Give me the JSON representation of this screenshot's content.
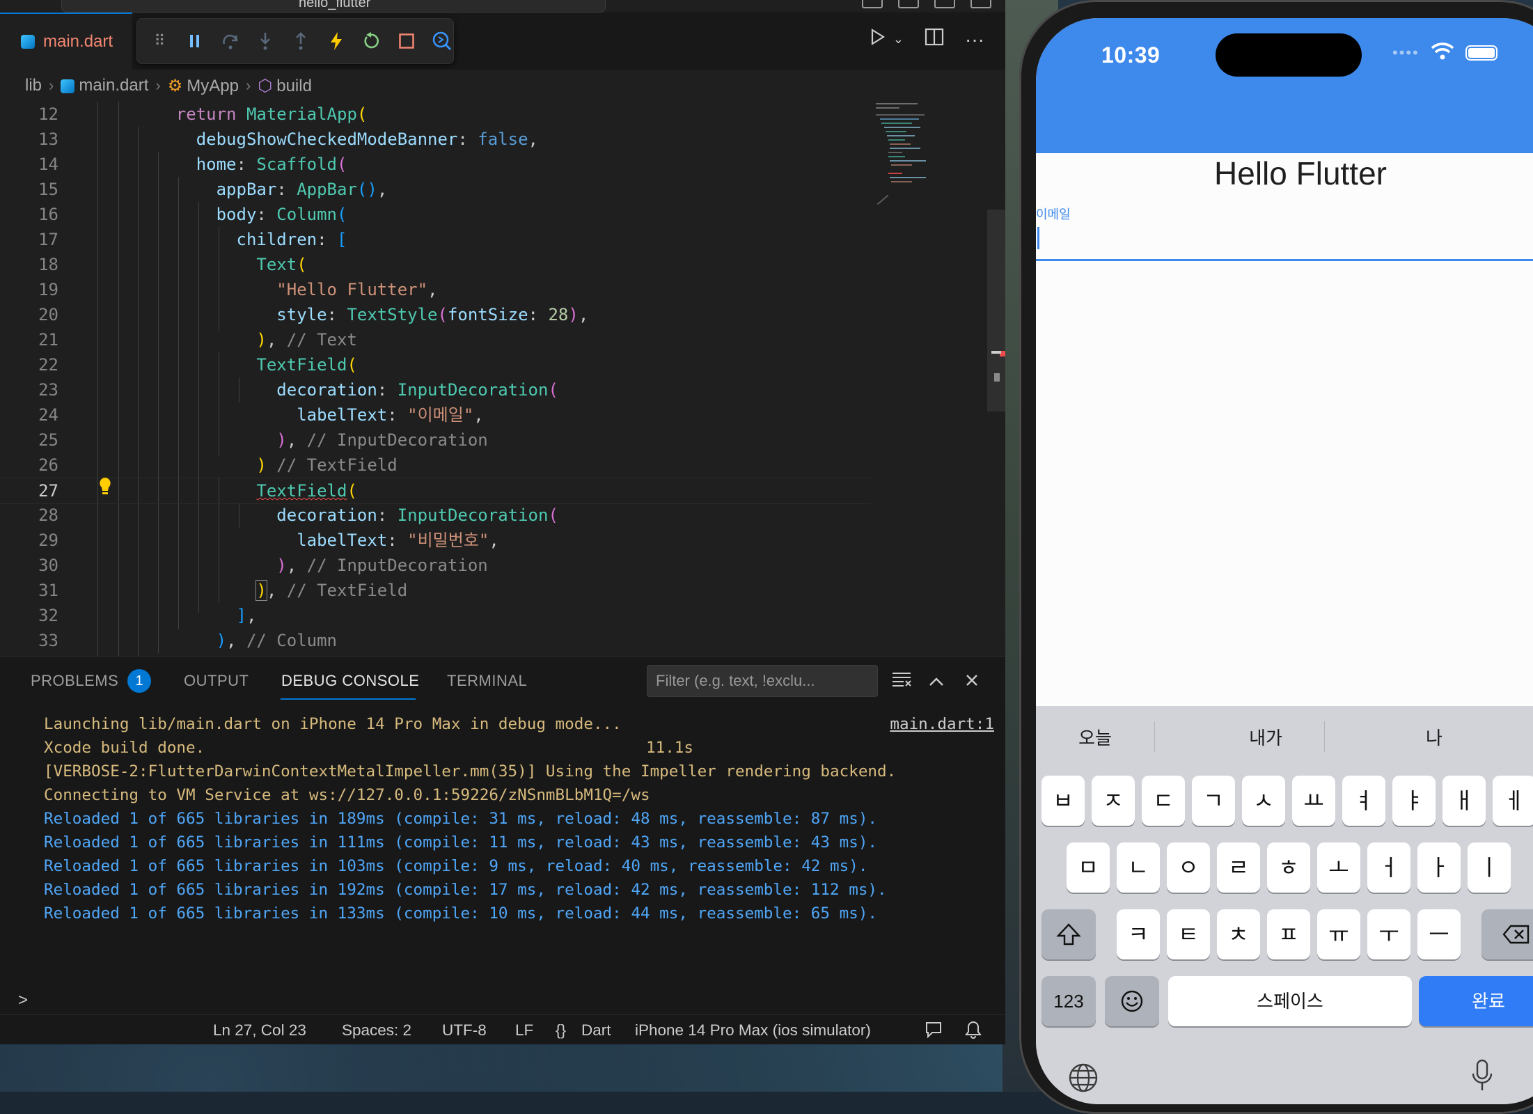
{
  "editor": {
    "tab_label": "main.dart",
    "command_center_label": "hello_flutter",
    "breadcrumb": [
      "lib",
      "main.dart",
      "MyApp",
      "build"
    ],
    "lines": [
      12,
      13,
      14,
      15,
      16,
      17,
      18,
      19,
      20,
      21,
      22,
      23,
      24,
      25,
      26,
      27,
      28,
      29,
      30,
      31,
      32,
      33
    ],
    "current_line": 27
  },
  "panel": {
    "tabs": [
      "PROBLEMS",
      "OUTPUT",
      "DEBUG CONSOLE",
      "TERMINAL"
    ],
    "problems_count": "1",
    "active_tab": "DEBUG CONSOLE",
    "filter_placeholder": "Filter (e.g. text, !exclu...",
    "source_link": "main.dart:1",
    "build_time": "11.1s",
    "console_lines": [
      "Launching lib/main.dart on iPhone 14 Pro Max in debug mode...",
      "Xcode build done.",
      "[VERBOSE-2:FlutterDarwinContextMetalImpeller.mm(35)] Using the Impeller rendering backend.",
      "Connecting to VM Service at ws://127.0.0.1:59226/zNSnmBLbM1Q=/ws",
      "Reloaded 1 of 665 libraries in 189ms (compile: 31 ms, reload: 48 ms, reassemble: 87 ms).",
      "Reloaded 1 of 665 libraries in 111ms (compile: 11 ms, reload: 43 ms, reassemble: 43 ms).",
      "Reloaded 1 of 665 libraries in 103ms (compile: 9 ms, reload: 40 ms, reassemble: 42 ms).",
      "Reloaded 1 of 665 libraries in 192ms (compile: 17 ms, reload: 42 ms, reassemble: 112 ms).",
      "Reloaded 1 of 665 libraries in 133ms (compile: 10 ms, reload: 44 ms, reassemble: 65 ms)."
    ],
    "repl_prompt": ">"
  },
  "statusbar": {
    "position": "Ln 27, Col 23",
    "spaces": "Spaces: 2",
    "encoding": "UTF-8",
    "eol": "LF",
    "language_braces": "{}",
    "language": "Dart",
    "device": "iPhone 14 Pro Max (ios simulator)"
  },
  "phone": {
    "time": "10:39",
    "title_text": "Hello Flutter",
    "field_label": "이메일",
    "suggestions": [
      "오늘",
      "내가",
      "나"
    ],
    "keys_row1": [
      "ㅂ",
      "ㅈ",
      "ㄷ",
      "ㄱ",
      "ㅅ",
      "ㅛ",
      "ㅕ",
      "ㅑ",
      "ㅐ",
      "ㅔ"
    ],
    "keys_row2": [
      "ㅁ",
      "ㄴ",
      "ㅇ",
      "ㄹ",
      "ㅎ",
      "ㅗ",
      "ㅓ",
      "ㅏ",
      "ㅣ"
    ],
    "keys_row3": [
      "ㅋ",
      "ㅌ",
      "ㅊ",
      "ㅍ",
      "ㅠ",
      "ㅜ",
      "ㅡ"
    ],
    "num_key": "123",
    "space_key": "스페이스",
    "done_key": "완료"
  },
  "colors": {
    "accent": "#0078d4",
    "flutter_primary": "#3e89ec",
    "console_yellow": "#d7ba7d",
    "console_blue": "#4fa6f7"
  },
  "icons": [
    "pause-icon",
    "step-over-icon",
    "step-into-icon",
    "step-out-icon",
    "hot-reload-icon",
    "restart-icon",
    "stop-icon",
    "devtools-icon",
    "run-icon",
    "split-editor-icon",
    "more-icon",
    "lightbulb-icon",
    "wifi-icon",
    "battery-icon",
    "shift-icon",
    "backspace-icon",
    "emoji-icon",
    "globe-icon",
    "mic-icon"
  ]
}
